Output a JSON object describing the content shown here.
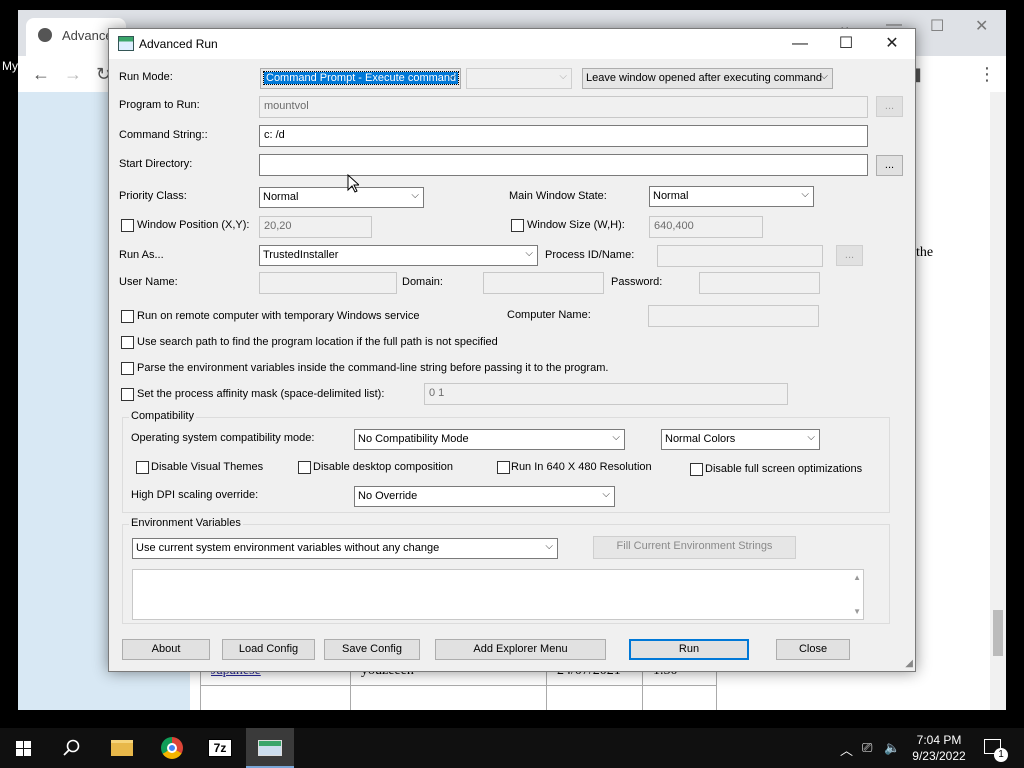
{
  "browser": {
    "tab_title": "Advance",
    "bookmark_text": "My",
    "side_text": "the",
    "table_rows": [
      [
        "Japanese",
        "youzeeen",
        "24/07/2021",
        "1.50"
      ],
      [
        "",
        "",
        "",
        ""
      ]
    ]
  },
  "dialog": {
    "title": "Advanced Run",
    "run_mode": {
      "label": "Run Mode:",
      "value": "Command Prompt - Execute command",
      "secondary_value": "",
      "window_option": "Leave window opened after executing command"
    },
    "program": {
      "label": "Program to Run:",
      "value": "mountvol",
      "browse": "..."
    },
    "command_string": {
      "label": "Command String::",
      "value": "c: /d"
    },
    "start_directory": {
      "label": "Start Directory:",
      "value": "",
      "browse": "..."
    },
    "priority": {
      "label": "Priority Class:",
      "value": "Normal"
    },
    "main_window_state": {
      "label": "Main Window State:",
      "value": "Normal"
    },
    "window_position": {
      "label": "Window Position (X,Y):",
      "value": "20,20",
      "checked": false
    },
    "window_size": {
      "label": "Window Size (W,H):",
      "value": "640,400",
      "checked": false
    },
    "run_as": {
      "label": "Run As...",
      "value": "TrustedInstaller"
    },
    "process_id": {
      "label": "Process ID/Name:",
      "value": "",
      "browse": "..."
    },
    "user_name": {
      "label": "User Name:",
      "value": ""
    },
    "domain": {
      "label": "Domain:",
      "value": ""
    },
    "password": {
      "label": "Password:",
      "value": ""
    },
    "remote": {
      "label": "Run on remote computer with temporary Windows service",
      "checked": false
    },
    "computer_name": {
      "label": "Computer Name:",
      "value": ""
    },
    "search_path": {
      "label": "Use search path to find the program location if the full path is not specified",
      "checked": false
    },
    "parse_env": {
      "label": "Parse the environment variables inside the command-line string before passing it to the program.",
      "checked": false
    },
    "affinity": {
      "label": "Set the process affinity mask (space-delimited list):",
      "value": "0 1",
      "checked": false
    },
    "compatibility": {
      "title": "Compatibility",
      "os_mode_label": "Operating system compatibility mode:",
      "os_mode_value": "No Compatibility Mode",
      "colors_value": "Normal Colors",
      "disable_visual_themes": "Disable Visual Themes",
      "disable_desktop_composition": "Disable desktop composition",
      "run_640": "Run In 640 X 480 Resolution",
      "disable_fullscreen_opt": "Disable full screen optimizations",
      "dpi_label": "High DPI scaling override:",
      "dpi_value": "No Override"
    },
    "environment": {
      "title": "Environment Variables",
      "mode_value": "Use current system environment variables without any change",
      "fill_button": "Fill Current Environment Strings",
      "text": ""
    },
    "buttons": {
      "about": "About",
      "load_config": "Load Config",
      "save_config": "Save Config",
      "add_explorer_menu": "Add Explorer Menu",
      "run": "Run",
      "close": "Close"
    }
  },
  "taskbar": {
    "time": "7:04 PM",
    "date": "9/23/2022",
    "notification_count": "1",
    "apps": [
      "file-explorer",
      "chrome",
      "7-zip",
      "advanced-run"
    ]
  }
}
